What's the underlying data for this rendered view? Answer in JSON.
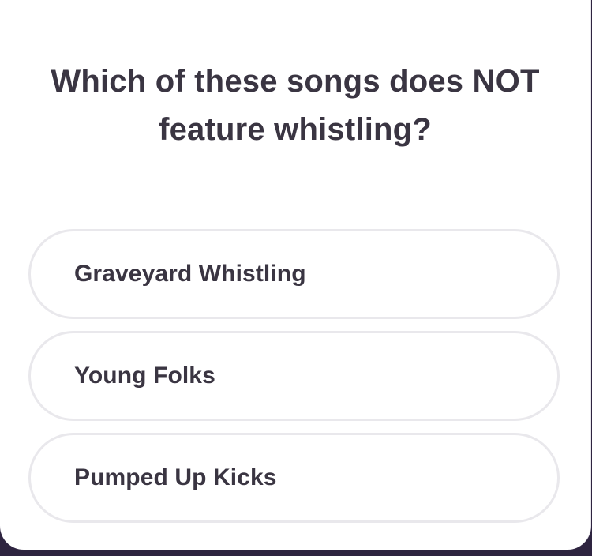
{
  "quiz": {
    "question_line1": "Which of these songs does NOT",
    "question_line2": "feature whistling?",
    "options": [
      {
        "label": "Graveyard Whistling"
      },
      {
        "label": "Young Folks"
      },
      {
        "label": "Pumped Up Kicks"
      }
    ]
  },
  "colors": {
    "background": "#2e2440",
    "card": "#ffffff",
    "text": "#3a3542",
    "option_border": "#e9e8ec"
  }
}
